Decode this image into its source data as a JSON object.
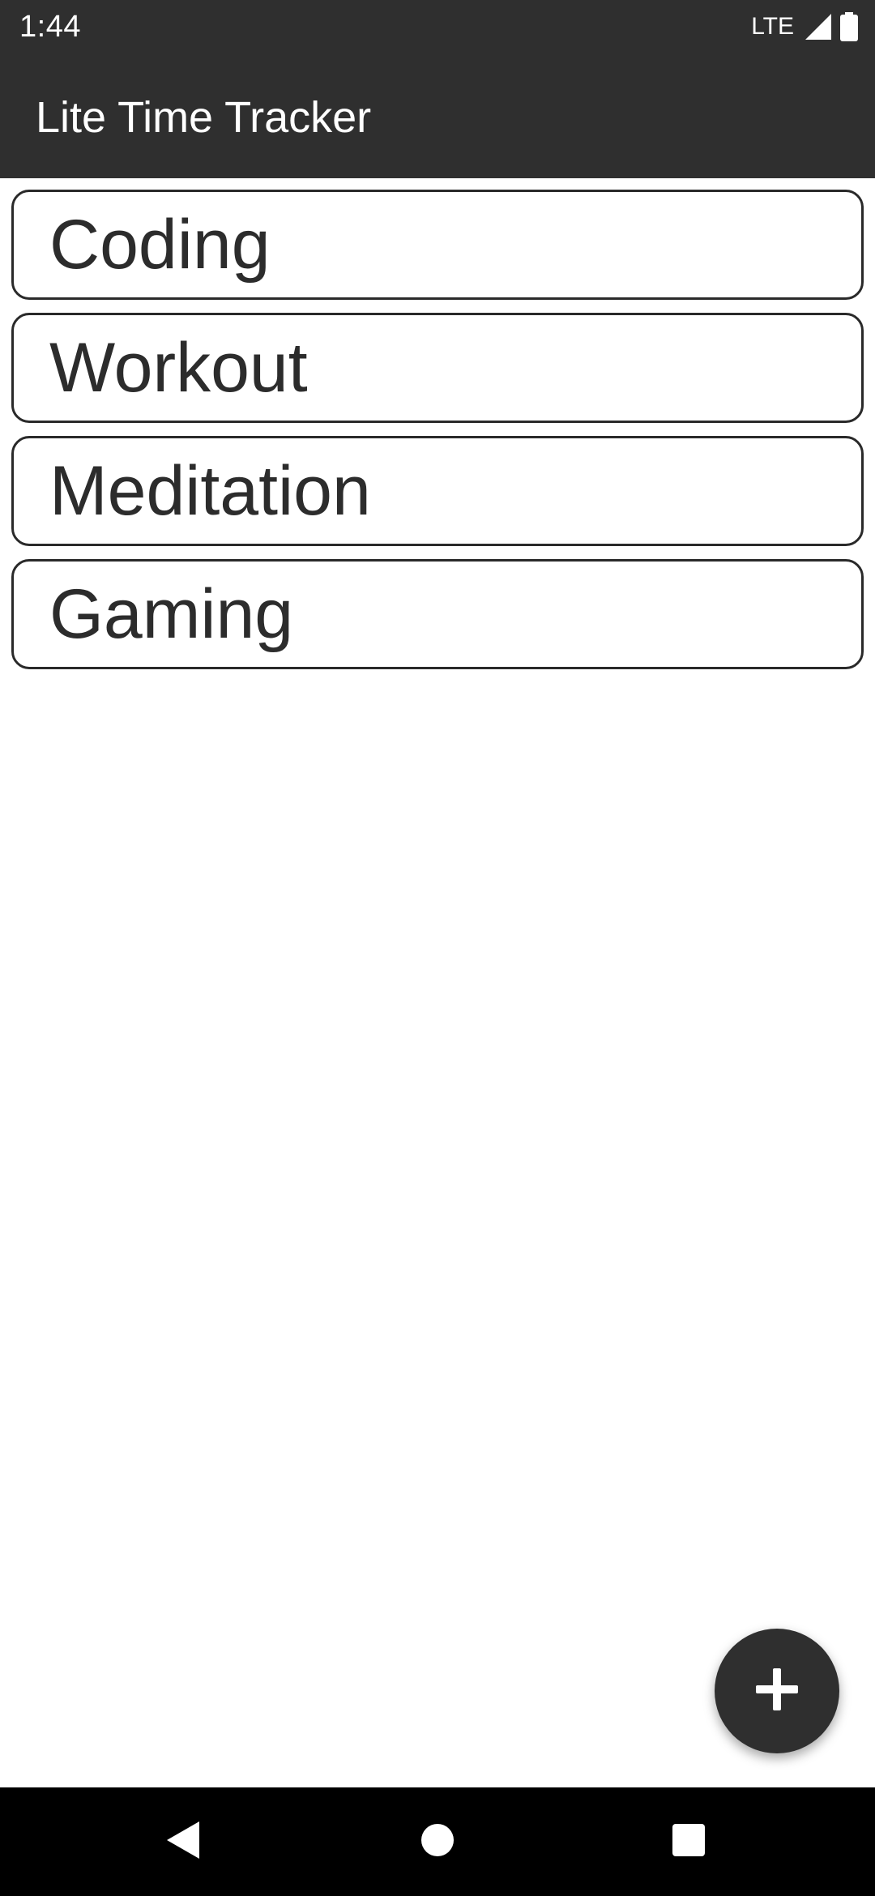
{
  "status_bar": {
    "time": "1:44",
    "network": "LTE",
    "icons": [
      "signal-icon",
      "battery-icon"
    ]
  },
  "app_bar": {
    "title": "Lite Time Tracker",
    "background_color": "#2f2f2f"
  },
  "activities": {
    "items": [
      {
        "label": "Coding"
      },
      {
        "label": "Workout"
      },
      {
        "label": "Meditation"
      },
      {
        "label": "Gaming"
      }
    ]
  },
  "fab": {
    "icon": "plus-icon",
    "color": "#2f2f2f"
  },
  "nav_bar": {
    "icons": [
      "back-icon",
      "home-icon",
      "recents-icon"
    ]
  }
}
